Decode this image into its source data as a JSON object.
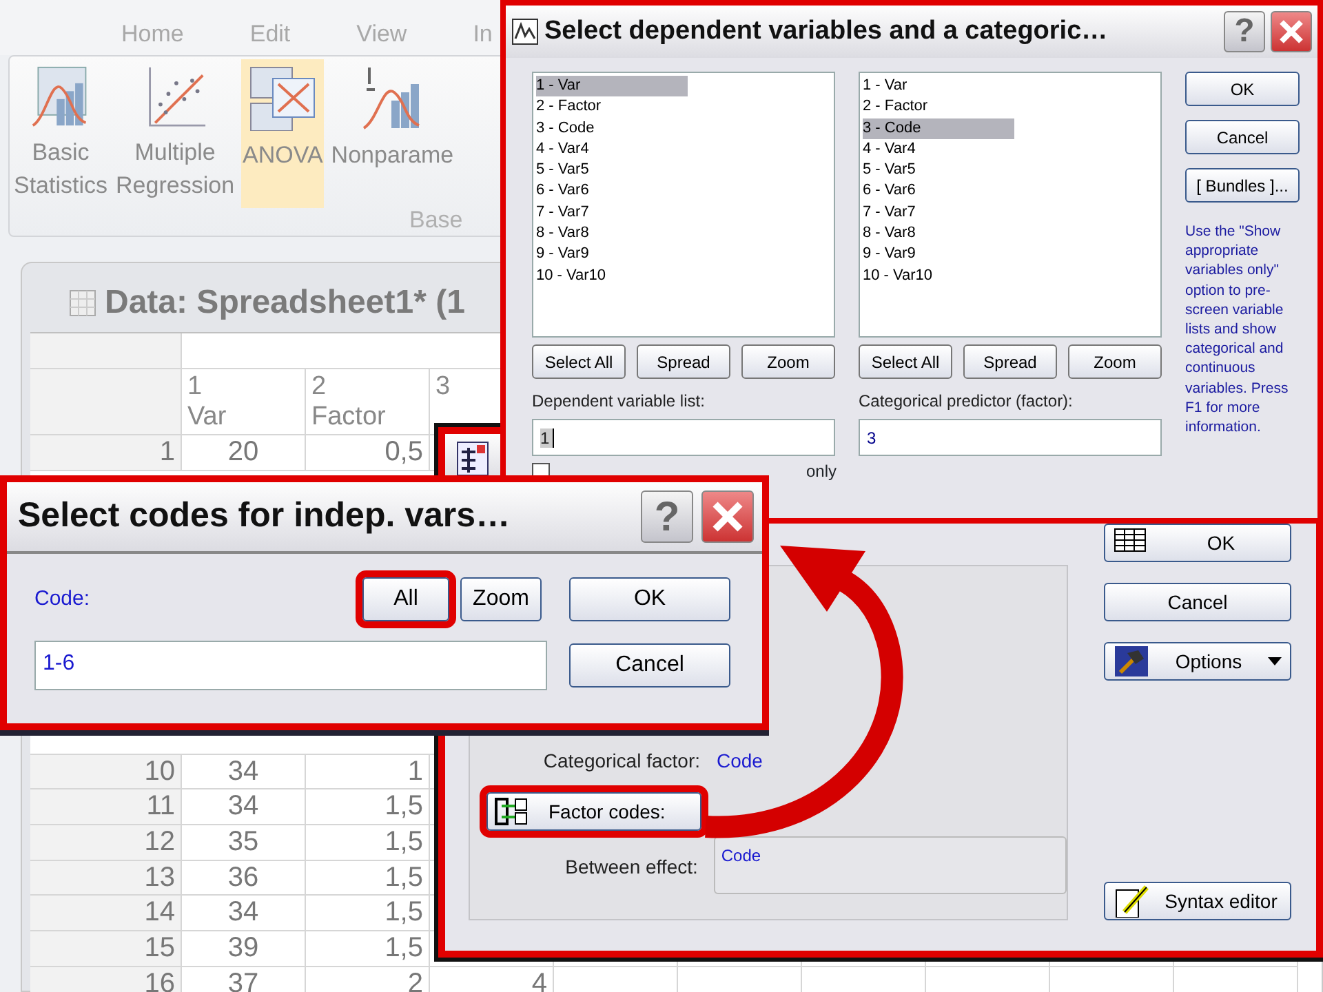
{
  "ribbon": {
    "tabs": [
      {
        "label": "Home"
      },
      {
        "label": "Edit"
      },
      {
        "label": "View"
      },
      {
        "label": "In"
      }
    ],
    "buttons": [
      {
        "label": "Basic\nStatistics",
        "kind": "histogram",
        "selected": false
      },
      {
        "label": "Multiple\nRegression",
        "kind": "scatter",
        "selected": false
      },
      {
        "label": "ANOVA",
        "kind": "anova",
        "selected": true
      },
      {
        "label": "Nonparame",
        "kind": "nonparam",
        "selected": false
      }
    ],
    "group_label": "Base"
  },
  "spreadsheet": {
    "title": "Data: Spreadsheet1* (1",
    "columns": [
      {
        "number": "1",
        "name": "Var"
      },
      {
        "number": "2",
        "name": "Factor"
      },
      {
        "number": "3"
      }
    ],
    "rows": [
      {
        "label": "1",
        "cells": [
          "20",
          "0,5"
        ]
      },
      {
        "label": "10",
        "cells": [
          "34",
          "1"
        ]
      },
      {
        "label": "11",
        "cells": [
          "34",
          "1,5"
        ]
      },
      {
        "label": "12",
        "cells": [
          "35",
          "1,5"
        ]
      },
      {
        "label": "13",
        "cells": [
          "36",
          "1,5"
        ]
      },
      {
        "label": "14",
        "cells": [
          "34",
          "1,5"
        ]
      },
      {
        "label": "15",
        "cells": [
          "39",
          "1,5"
        ]
      },
      {
        "label": "16",
        "cells": [
          "37",
          "2",
          "4"
        ]
      }
    ]
  },
  "analysis_dialog": {
    "buttons": [
      {
        "label": "OK",
        "kind": "grid"
      },
      {
        "label": "Cancel",
        "kind": "plain"
      },
      {
        "label": "Options",
        "kind": "options"
      },
      {
        "label": "Syntax editor",
        "kind": "syntax"
      }
    ],
    "categorical_factor": {
      "label": "Categorical factor:",
      "value": "Code"
    },
    "factor_codes": {
      "label": "Factor codes:",
      "highlighted": true
    },
    "between_effect": {
      "label": "Between effect:",
      "value": "Code"
    }
  },
  "variables_dialog": {
    "title": "Select dependent variables and a categoric…",
    "help": "?",
    "lists": [
      {
        "items": [
          {
            "label": "1 - Var",
            "selected": true
          },
          {
            "label": "2 - Factor",
            "selected": false
          },
          {
            "label": "3 - Code",
            "selected": false
          },
          {
            "label": "4 - Var4",
            "selected": false
          },
          {
            "label": "5 - Var5",
            "selected": false
          },
          {
            "label": "6 - Var6",
            "selected": false
          },
          {
            "label": "7 - Var7",
            "selected": false
          },
          {
            "label": "8 - Var8",
            "selected": false
          },
          {
            "label": "9 - Var9",
            "selected": false
          },
          {
            "label": "10 - Var10",
            "selected": false
          }
        ],
        "buttons": [
          "Select All",
          "Spread",
          "Zoom"
        ],
        "field_label": "Dependent variable list:",
        "field_value": "1"
      },
      {
        "items": [
          {
            "label": "1 - Var",
            "selected": false
          },
          {
            "label": "2 - Factor",
            "selected": false
          },
          {
            "label": "3 - Code",
            "selected": true
          },
          {
            "label": "4 - Var4",
            "selected": false
          },
          {
            "label": "5 - Var5",
            "selected": false
          },
          {
            "label": "6 - Var6",
            "selected": false
          },
          {
            "label": "7 - Var7",
            "selected": false
          },
          {
            "label": "8 - Var8",
            "selected": false
          },
          {
            "label": "9 - Var9",
            "selected": false
          },
          {
            "label": "10 - Var10",
            "selected": false
          }
        ],
        "buttons": [
          "Select All",
          "Spread",
          "Zoom"
        ],
        "field_label": "Categorical predictor (factor):",
        "field_value": "3"
      }
    ],
    "buttons": [
      "OK",
      "Cancel",
      "[ Bundles ]..."
    ],
    "help_text": "Use the \"Show appropriate variables only\" option to pre-screen variable lists and show categorical and continuous variables. Press F1 for more information.",
    "checkbox": {
      "label": "only",
      "checked": false
    }
  },
  "codes_dialog": {
    "title": "Select codes for indep. vars…",
    "help": "?",
    "label": "Code:",
    "value": "1-6",
    "buttons": [
      {
        "label": "All",
        "highlighted": true
      },
      {
        "label": "Zoom",
        "highlighted": false
      },
      {
        "label": "OK",
        "highlighted": false
      },
      {
        "label": "Cancel",
        "highlighted": false
      }
    ]
  }
}
